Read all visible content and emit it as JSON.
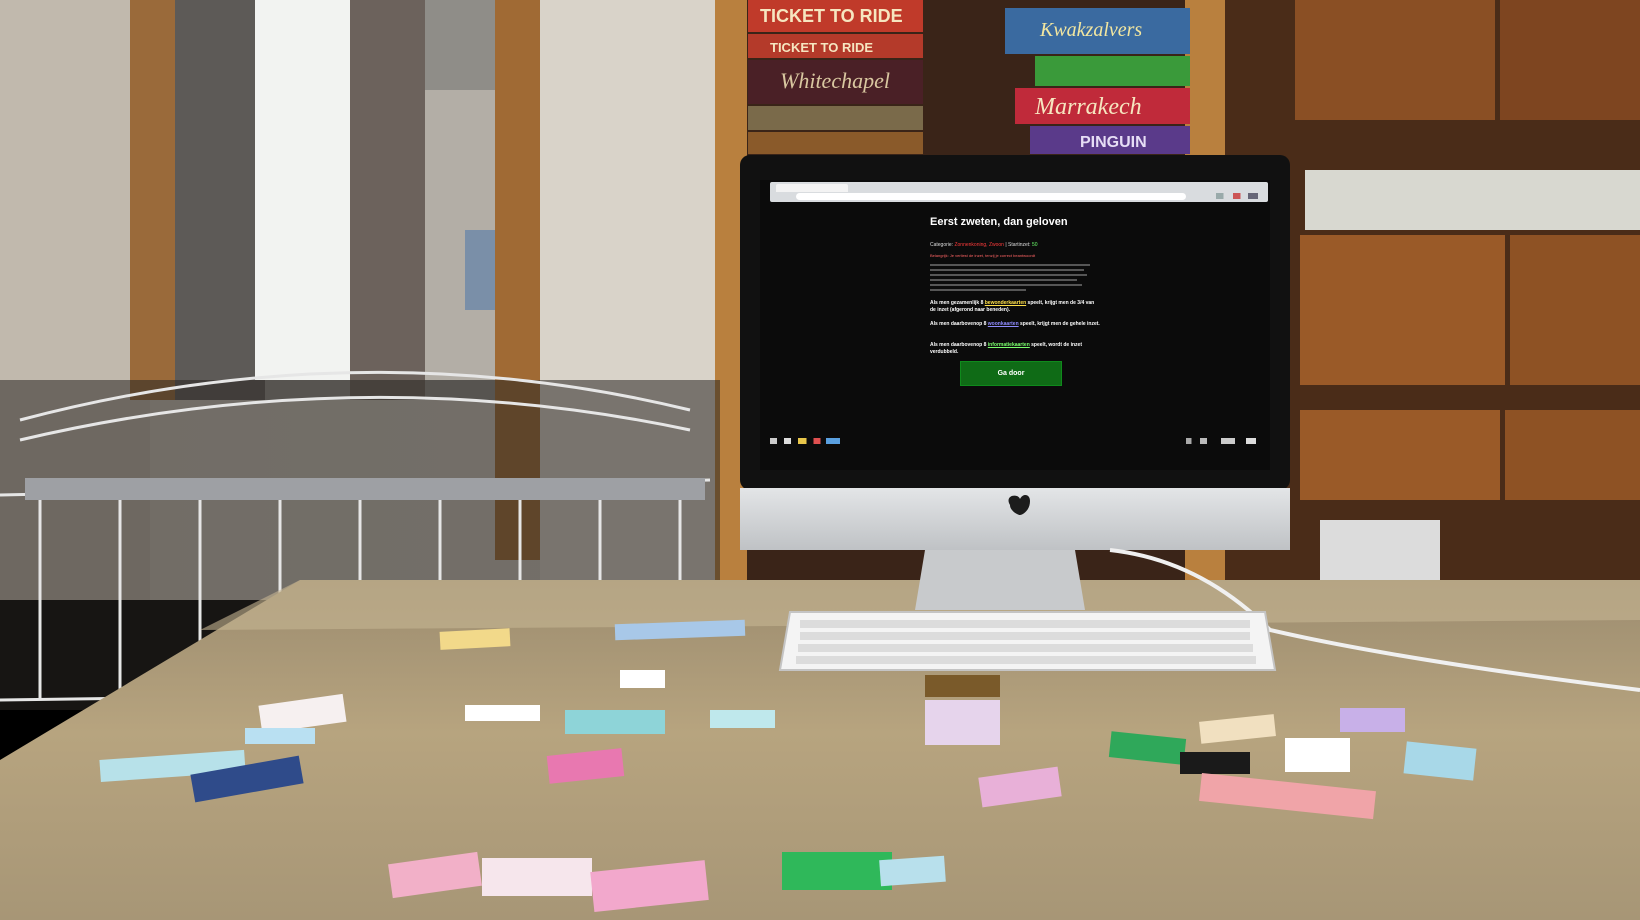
{
  "screen": {
    "heading": "Eerst zweten, dan geloven",
    "category_label": "Categorie:",
    "category_value": "Zonnenkoning, Zwoon",
    "separator": " | ",
    "bet_label": "Startinzet:",
    "bet_value": "50",
    "notice": "Belangrijk: Je verliest de inzet, tenzij je correct beantwoordt",
    "rules": [
      {
        "prefix": "Als men gezamenlijk 8",
        "card": "bewonderkaarten",
        "suffix": "speelt, krijgt men de 3/4 van de inzet (afgerond naar beneden)."
      },
      {
        "prefix": "Als men daarbovenop 8",
        "card": "woonkaarten",
        "suffix": "speelt, krijgt men de gehele inzet."
      },
      {
        "prefix": "Als men daarbovenop 8",
        "card": "informatiekaarten",
        "suffix": "speelt, wordt de inzet verdubbeld."
      }
    ],
    "go_button": "Ga door"
  },
  "games_on_shelf": [
    "TICKET TO RIDE",
    "TICKET TO RIDE",
    "Whitechapel",
    "Kwakzalvers",
    "Marrakech",
    "PINGUIN"
  ],
  "colors": {
    "screen_background": "#0b0b0b",
    "button_green": "#0f6b16",
    "category_red": "#ff3b3b",
    "bet_green": "#6cff6c",
    "card_yellow": "#ffe04a",
    "card_purple": "#8f8cff",
    "card_green": "#7bff6e"
  }
}
